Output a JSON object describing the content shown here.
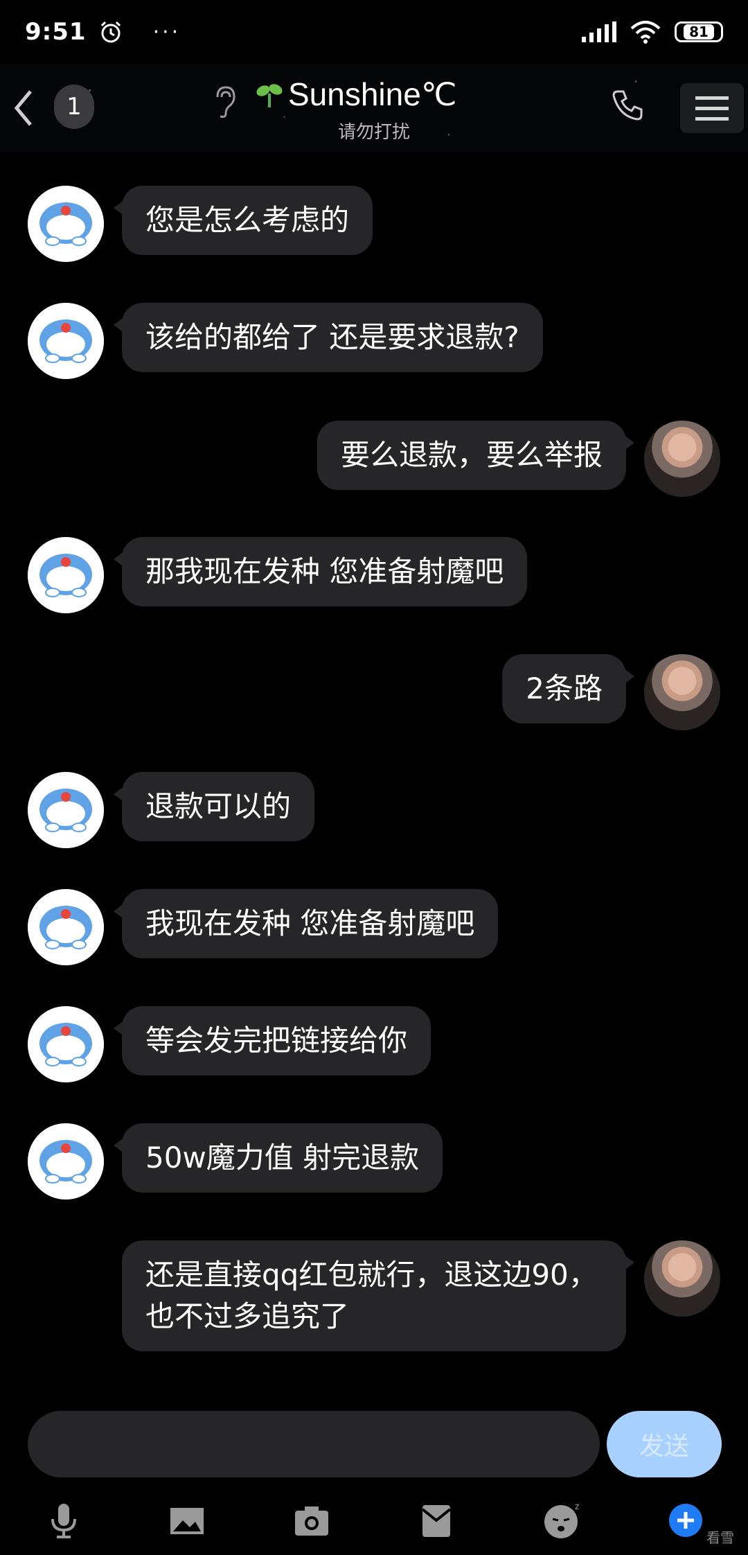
{
  "status_bar": {
    "time": "9:51",
    "more": "···",
    "battery": "81"
  },
  "header": {
    "unread_count": "1",
    "contact_name": "Sunshine℃",
    "status_text": "请勿打扰"
  },
  "messages": [
    {
      "side": "left",
      "text": "您是怎么考虑的"
    },
    {
      "side": "left",
      "text": "该给的都给了 还是要求退款?"
    },
    {
      "side": "right",
      "text": "要么退款，要么举报"
    },
    {
      "side": "left",
      "text": "那我现在发种 您准备射魔吧"
    },
    {
      "side": "right",
      "text": "2条路"
    },
    {
      "side": "left",
      "text": "退款可以的"
    },
    {
      "side": "left",
      "text": "我现在发种 您准备射魔吧"
    },
    {
      "side": "left",
      "text": "等会发完把链接给你"
    },
    {
      "side": "left",
      "text": "50w魔力值 射完退款"
    },
    {
      "side": "right",
      "text": "还是直接qq红包就行，退这边90，也不过多追究了"
    }
  ],
  "input": {
    "send_label": "发送"
  },
  "toolbar": {
    "icons": [
      "microphone-icon",
      "image-icon",
      "camera-icon",
      "red-packet-icon",
      "emoji-icon",
      "plus-icon"
    ]
  },
  "watermark": "看雪"
}
